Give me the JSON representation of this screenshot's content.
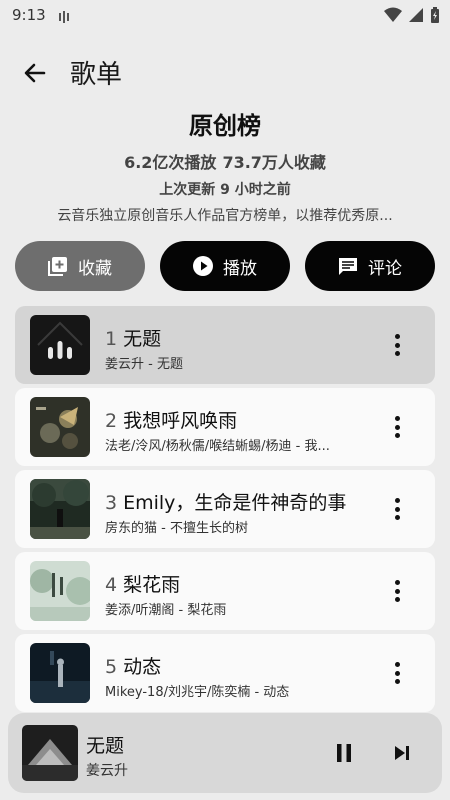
{
  "status_bar": {
    "time": "9:13"
  },
  "top_bar": {
    "title": "歌单"
  },
  "playlist": {
    "name": "原创榜",
    "plays": "6.2亿次播放",
    "favorites": "73.7万人收藏",
    "updated": "上次更新 9 小时之前",
    "description": "云音乐独立原创音乐人作品官方榜单，以推荐优秀原..."
  },
  "actions": {
    "favorite_label": "收藏",
    "play_label": "播放",
    "comment_label": "评论"
  },
  "songs": [
    {
      "index": "1",
      "title": "无题",
      "subtitle": "姜云升 - 无题",
      "active": true
    },
    {
      "index": "2",
      "title": "我想呼风唤雨",
      "subtitle": "法老/泠风/杨秋儒/喉结蜥蜴/杨迪 - 我...",
      "active": false
    },
    {
      "index": "3",
      "title": "Emily，生命是件神奇的事",
      "subtitle": "房东的猫 - 不擅生长的树",
      "active": false
    },
    {
      "index": "4",
      "title": "梨花雨",
      "subtitle": "姜添/听潮阁 - 梨花雨",
      "active": false
    },
    {
      "index": "5",
      "title": "动态",
      "subtitle": "Mikey-18/刘兆宇/陈奕楠 - 动态",
      "active": false
    }
  ],
  "now_playing": {
    "title": "无题",
    "artist": "姜云升"
  }
}
